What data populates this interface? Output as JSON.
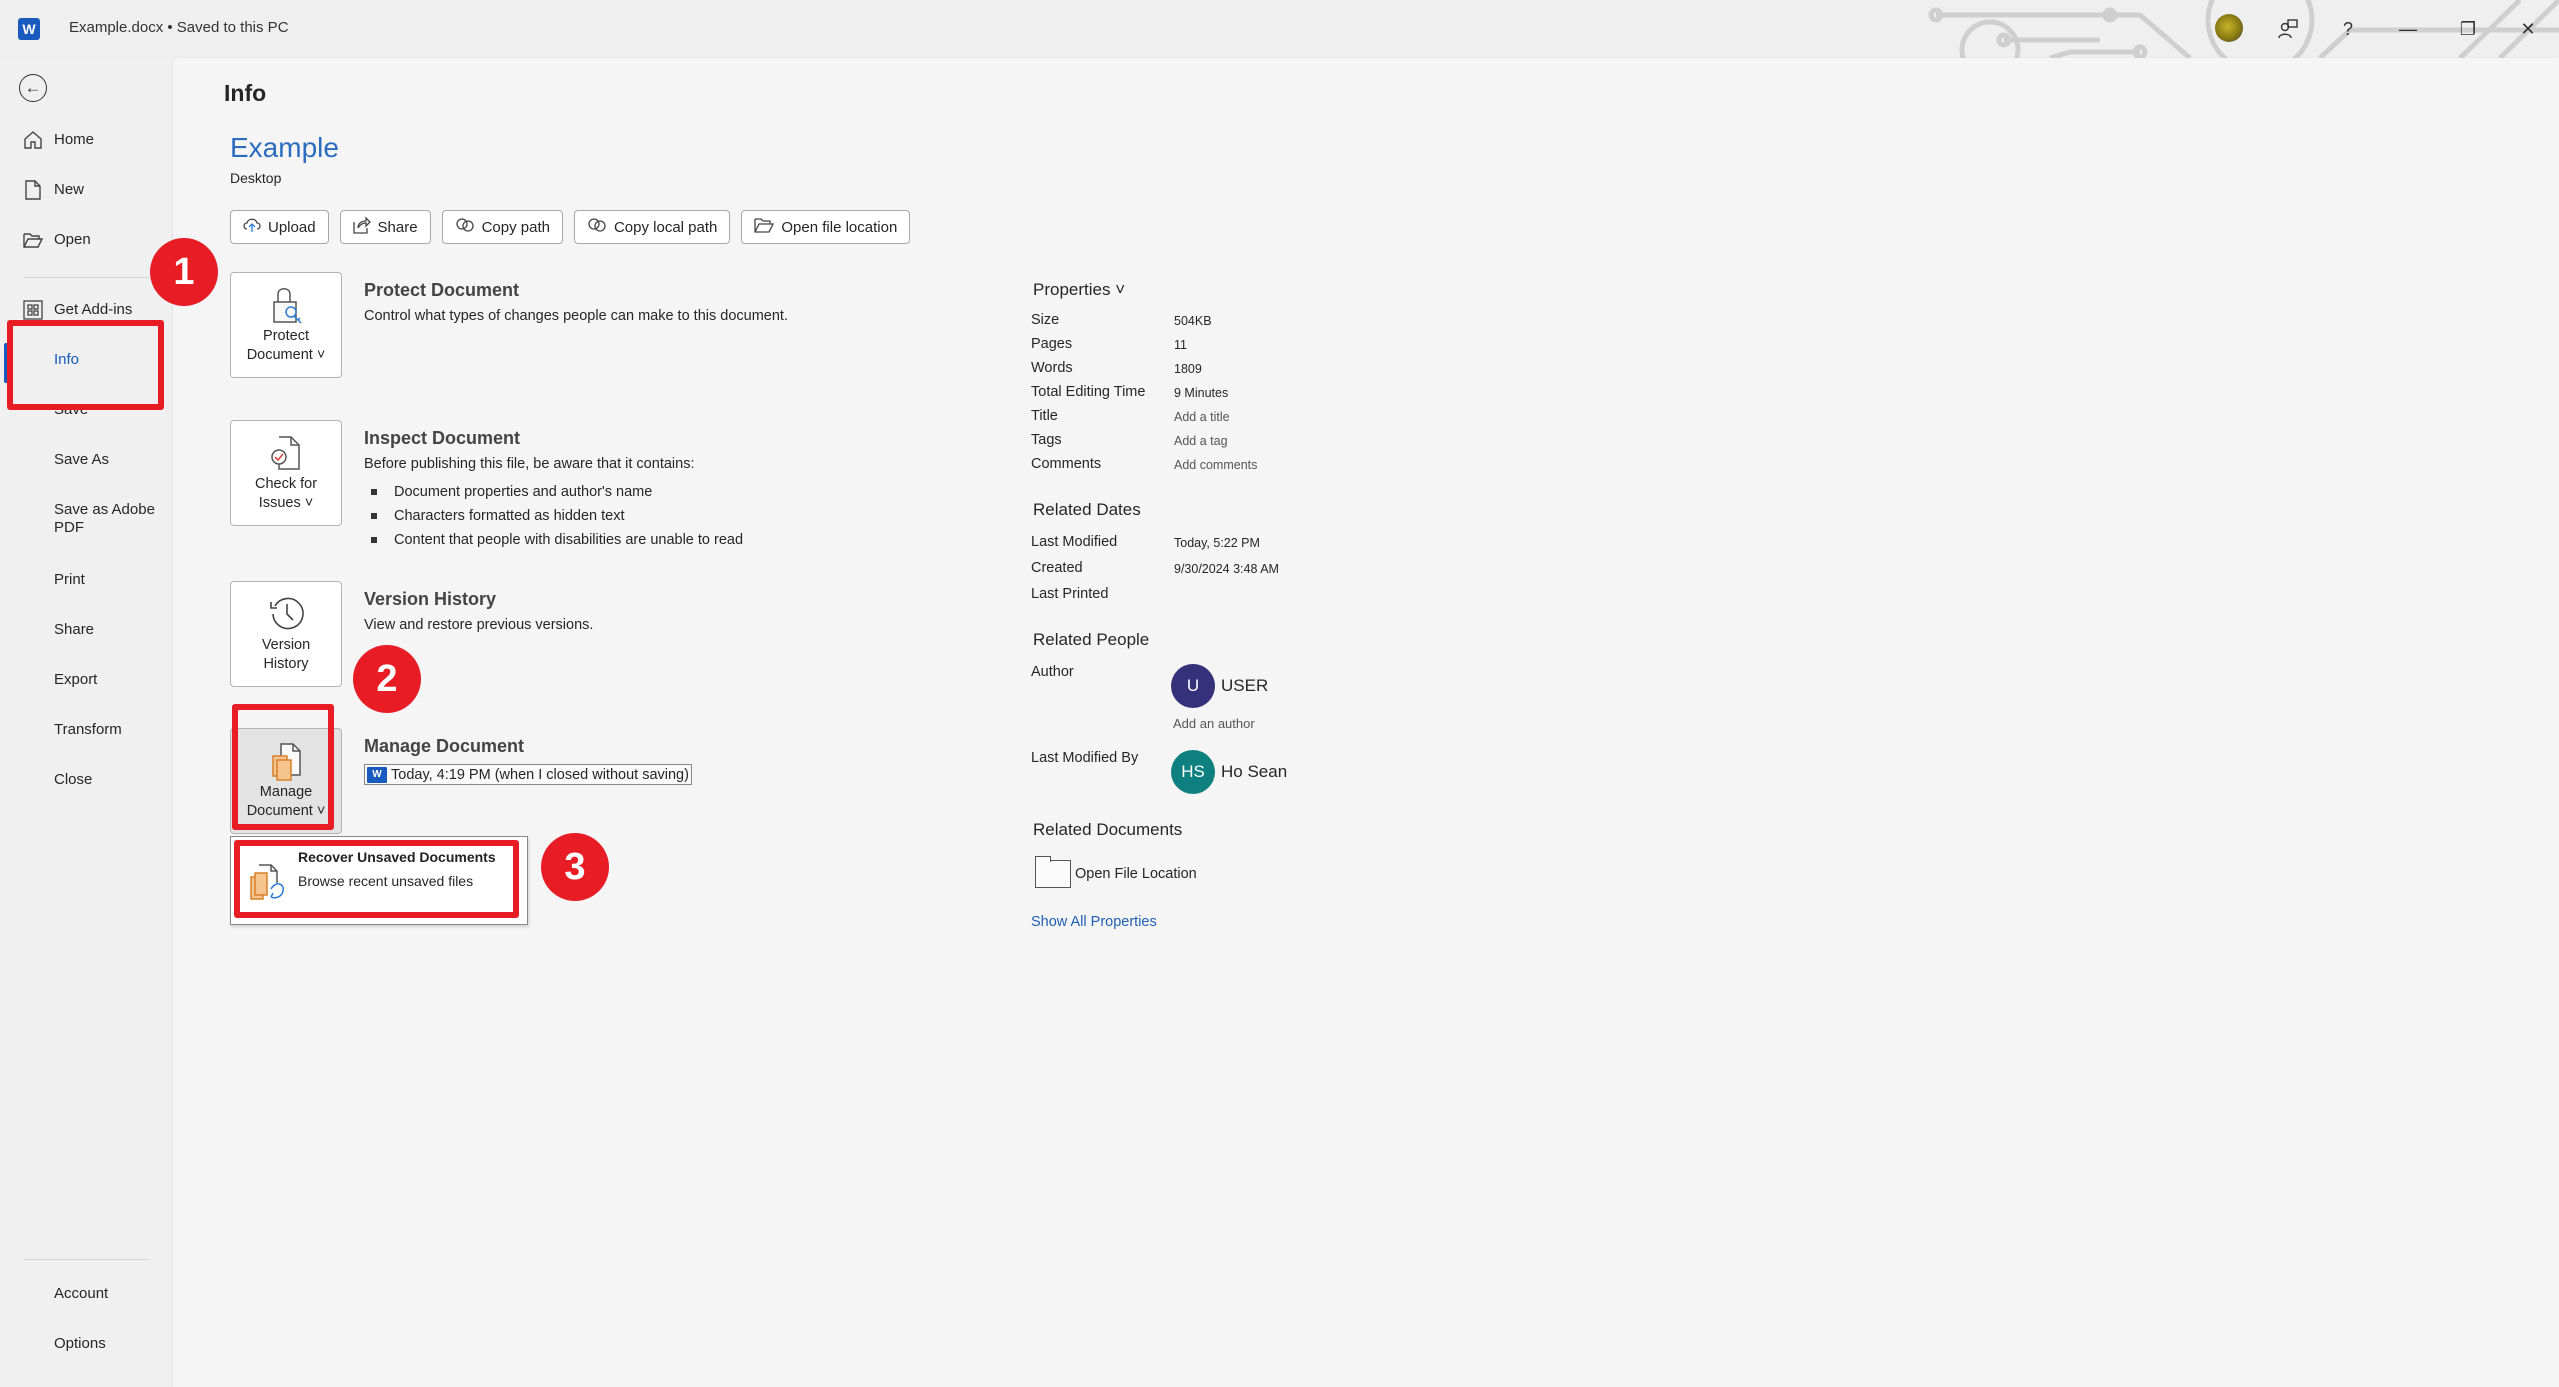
{
  "titlebar": {
    "app_icon_letter": "W",
    "document_title": "Example.docx • Saved to this PC",
    "icons": [
      "profile-avatar",
      "coauthor-icon",
      "help-icon",
      "minimize-icon",
      "restore-icon",
      "close-icon"
    ],
    "help_label": "?",
    "minimize_label": "—",
    "restore_label": "❐",
    "close_label": "✕"
  },
  "sidebar": {
    "back_icon": "←",
    "items": [
      {
        "label": "Home",
        "icon": "⌂"
      },
      {
        "label": "New",
        "icon": "🗋"
      },
      {
        "label": "Open",
        "icon": "🗁"
      },
      {
        "label": "Get Add-ins",
        "icon": "⊞"
      },
      {
        "label": "Info"
      },
      {
        "label": "Save"
      },
      {
        "label": "Save As"
      },
      {
        "label": "Save as Adobe PDF"
      },
      {
        "label": "Print"
      },
      {
        "label": "Share"
      },
      {
        "label": "Export"
      },
      {
        "label": "Transform"
      },
      {
        "label": "Close"
      },
      {
        "label": "Account"
      },
      {
        "label": "Options"
      }
    ],
    "active": "Info"
  },
  "main": {
    "page_title": "Info",
    "document_name": "Example",
    "document_location": "Desktop",
    "actions": [
      {
        "label": "Upload",
        "icon": "☁"
      },
      {
        "label": "Share",
        "icon": "⇪"
      },
      {
        "label": "Copy path",
        "icon": "∞"
      },
      {
        "label": "Copy local path",
        "icon": "∞"
      },
      {
        "label": "Open file location",
        "icon": "🗁"
      }
    ],
    "protect": {
      "button_line1": "Protect",
      "button_line2": "Document ˅",
      "title": "Protect Document",
      "description": "Control what types of changes people can make to this document."
    },
    "inspect": {
      "button_line1": "Check for",
      "button_line2": "Issues ˅",
      "title": "Inspect Document",
      "description": "Before publishing this file, be aware that it contains:",
      "items": [
        "Document properties and author's name",
        "Characters formatted as hidden text",
        "Content that people with disabilities are unable to read"
      ]
    },
    "version_history": {
      "button_line1": "Version",
      "button_line2": "History",
      "title": "Version History",
      "description": "View and restore previous versions."
    },
    "manage": {
      "button_line1": "Manage",
      "button_line2": "Document ˅",
      "title": "Manage Document",
      "autosave_entry": "Today, 4:19 PM (when I closed without saving)",
      "dropdown": {
        "title": "Recover Unsaved Documents",
        "description": "Browse recent unsaved files"
      }
    }
  },
  "properties": {
    "header": "Properties ˅",
    "rows": [
      {
        "key": "Size",
        "value": "504KB"
      },
      {
        "key": "Pages",
        "value": "11"
      },
      {
        "key": "Words",
        "value": "1809"
      },
      {
        "key": "Total Editing Time",
        "value": "9 Minutes"
      },
      {
        "key": "Title",
        "value": "Add a title"
      },
      {
        "key": "Tags",
        "value": "Add a tag"
      },
      {
        "key": "Comments",
        "value": "Add comments"
      }
    ],
    "related_dates": {
      "header": "Related Dates",
      "rows": [
        {
          "key": "Last Modified",
          "value": "Today, 5:22 PM"
        },
        {
          "key": "Created",
          "value": "9/30/2024 3:48 AM"
        },
        {
          "key": "Last Printed",
          "value": ""
        }
      ]
    },
    "related_people": {
      "header": "Related People",
      "author_label": "Author",
      "author_initials": "U",
      "author_name": "USER",
      "author_color": "#35317a",
      "add_author": "Add an author",
      "last_modified_by_label": "Last Modified By",
      "modifier_initials": "HS",
      "modifier_name": "Ho Sean",
      "modifier_color": "#0f8080"
    },
    "related_documents": {
      "header": "Related Documents",
      "open_location": "Open File Location"
    },
    "show_all": "Show All Properties"
  },
  "annotations": {
    "color": "#e81c24",
    "badges": [
      "1",
      "2",
      "3"
    ]
  }
}
